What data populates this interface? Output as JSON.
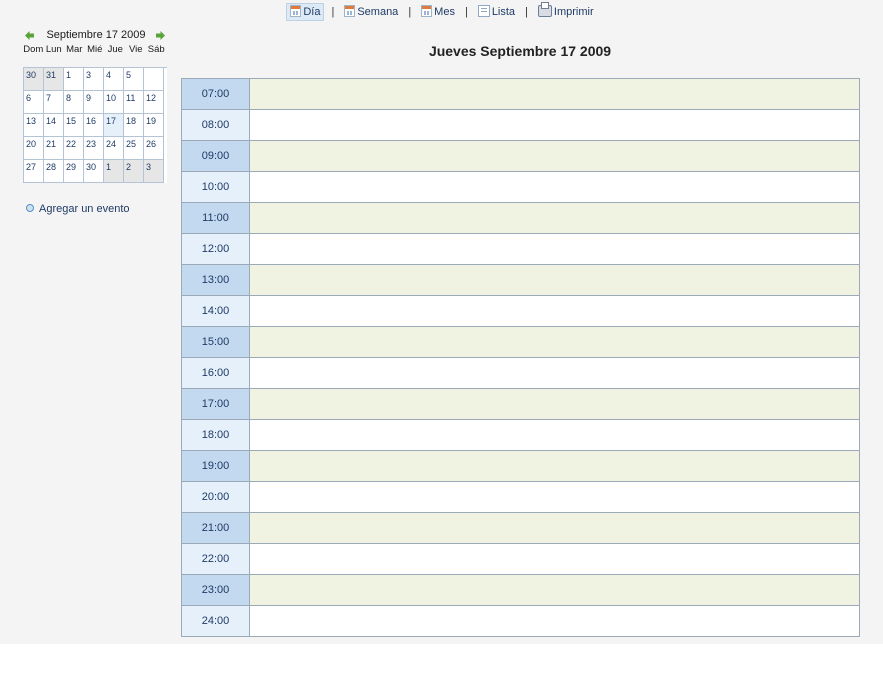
{
  "toolbar": {
    "items": [
      {
        "label": "Día",
        "icon": "calendar-day-icon"
      },
      {
        "label": "Semana",
        "icon": "calendar-week-icon"
      },
      {
        "label": "Mes",
        "icon": "calendar-month-icon"
      },
      {
        "label": "Lista",
        "icon": "list-icon"
      },
      {
        "label": "Imprimir",
        "icon": "printer-icon"
      }
    ],
    "active": "Día"
  },
  "mini_calendar": {
    "title": "Septiembre 17 2009",
    "weekdays": [
      "Dom",
      "Lun",
      "Mar",
      "Mié",
      "Jue",
      "Vie",
      "Sáb"
    ],
    "weeks": [
      [
        "30",
        "31",
        "1",
        "3",
        "4",
        "5",
        ""
      ],
      [
        "6",
        "7",
        "8",
        "9",
        "10",
        "11",
        "12"
      ],
      [
        "13",
        "14",
        "15",
        "16",
        "17",
        "18",
        "19"
      ],
      [
        "20",
        "21",
        "22",
        "23",
        "24",
        "25",
        "26"
      ],
      [
        "27",
        "28",
        "29",
        "30",
        "1",
        "2",
        "3"
      ]
    ],
    "selected_day": "17"
  },
  "sidebar": {
    "add_event": "Agregar un evento"
  },
  "day_view": {
    "title": "Jueves Septiembre 17 2009",
    "hours": [
      "07:00",
      "08:00",
      "09:00",
      "10:00",
      "11:00",
      "12:00",
      "13:00",
      "14:00",
      "15:00",
      "16:00",
      "17:00",
      "18:00",
      "19:00",
      "20:00",
      "21:00",
      "22:00",
      "23:00",
      "24:00"
    ]
  },
  "colors": {
    "link": "#1f3b66",
    "hour_label_dark": "#c3d9ef",
    "hour_label_light": "#e5f0fa",
    "slot_tinted": "#f0f2e2",
    "grid_border": "#9aaab8",
    "arrow_green": "#5aa33a"
  }
}
